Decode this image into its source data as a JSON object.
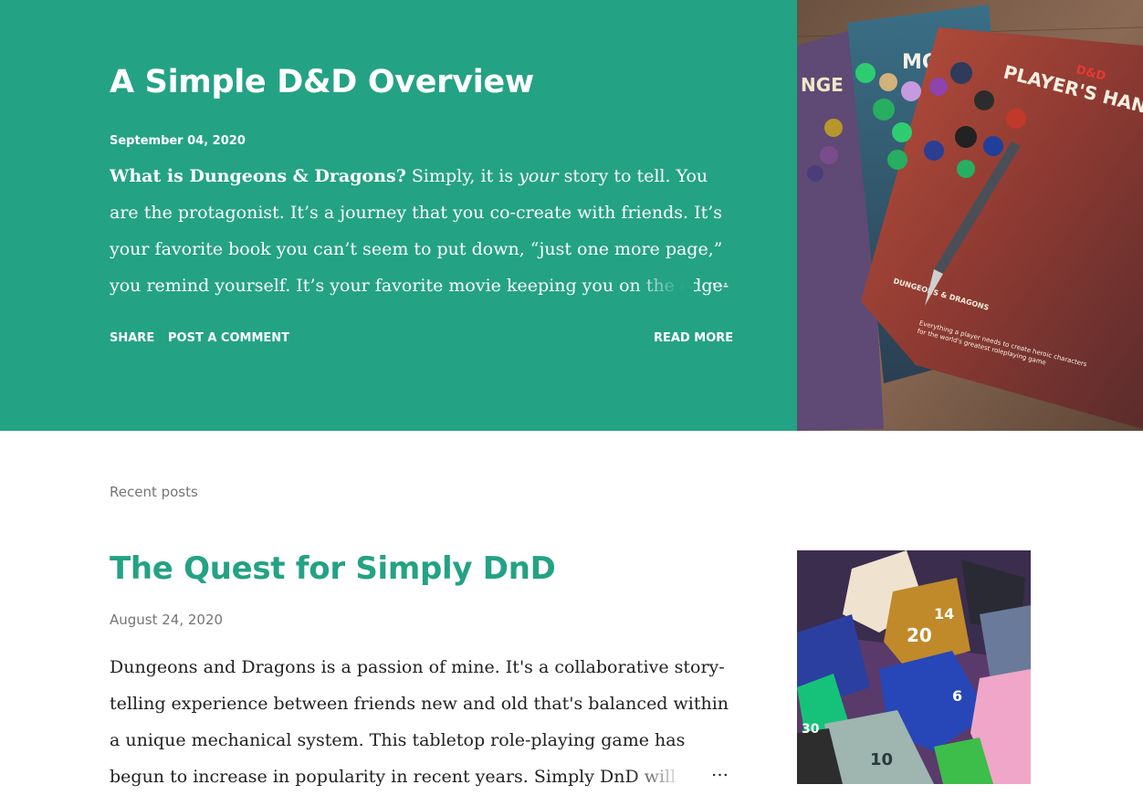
{
  "featured": {
    "title": "A Simple D&D Overview",
    "date": "September 04, 2020",
    "snippet_lead": "What is Dungeons & Dragons?",
    "snippet_part1": " Simply, it is ",
    "snippet_em": "your",
    "snippet_part2": " story to tell. You are the protagonist. It’s a journey that you co-create with friends. It’s your favorite book you can’t seem to put down, “just one more page,” you remind yourself. It’s your favorite movie keeping you on the edge-of-",
    "ellipsis": "…",
    "share_label": "SHARE",
    "comment_label": "POST A COMMENT",
    "read_more_label": "READ MORE",
    "image_icon": "dnd-books-and-dice-photo",
    "image_text": {
      "book_title": "PLAYER'S HANDBOOK",
      "brand": "D&D",
      "other_book": "MONS",
      "side_book": "NGE",
      "publisher": "DUNGEONS & DRAGONS",
      "tagline": "Everything a player needs to create heroic characters for the world's greatest roleplaying game"
    }
  },
  "recent": {
    "section_title": "Recent posts",
    "posts": [
      {
        "title": "The Quest for Simply DnD",
        "date": "August 24, 2020",
        "snippet": "Dungeons and Dragons is a passion of mine. It's a collaborative story-telling experience between friends new and old that's balanced within a unique mechanical system. This tabletop role-playing game has begun to increase in popularity in recent years. Simply DnD will investigate th",
        "ellipsis": "…",
        "image_icon": "polyhedral-dice-photo",
        "image_text": {
          "die1": "14",
          "die2": "20",
          "die3": "6",
          "die4": "10",
          "die5": "30"
        }
      }
    ]
  },
  "colors": {
    "accent": "#24a284",
    "muted": "#757575",
    "body_text": "#212121",
    "background": "#ffffff"
  }
}
